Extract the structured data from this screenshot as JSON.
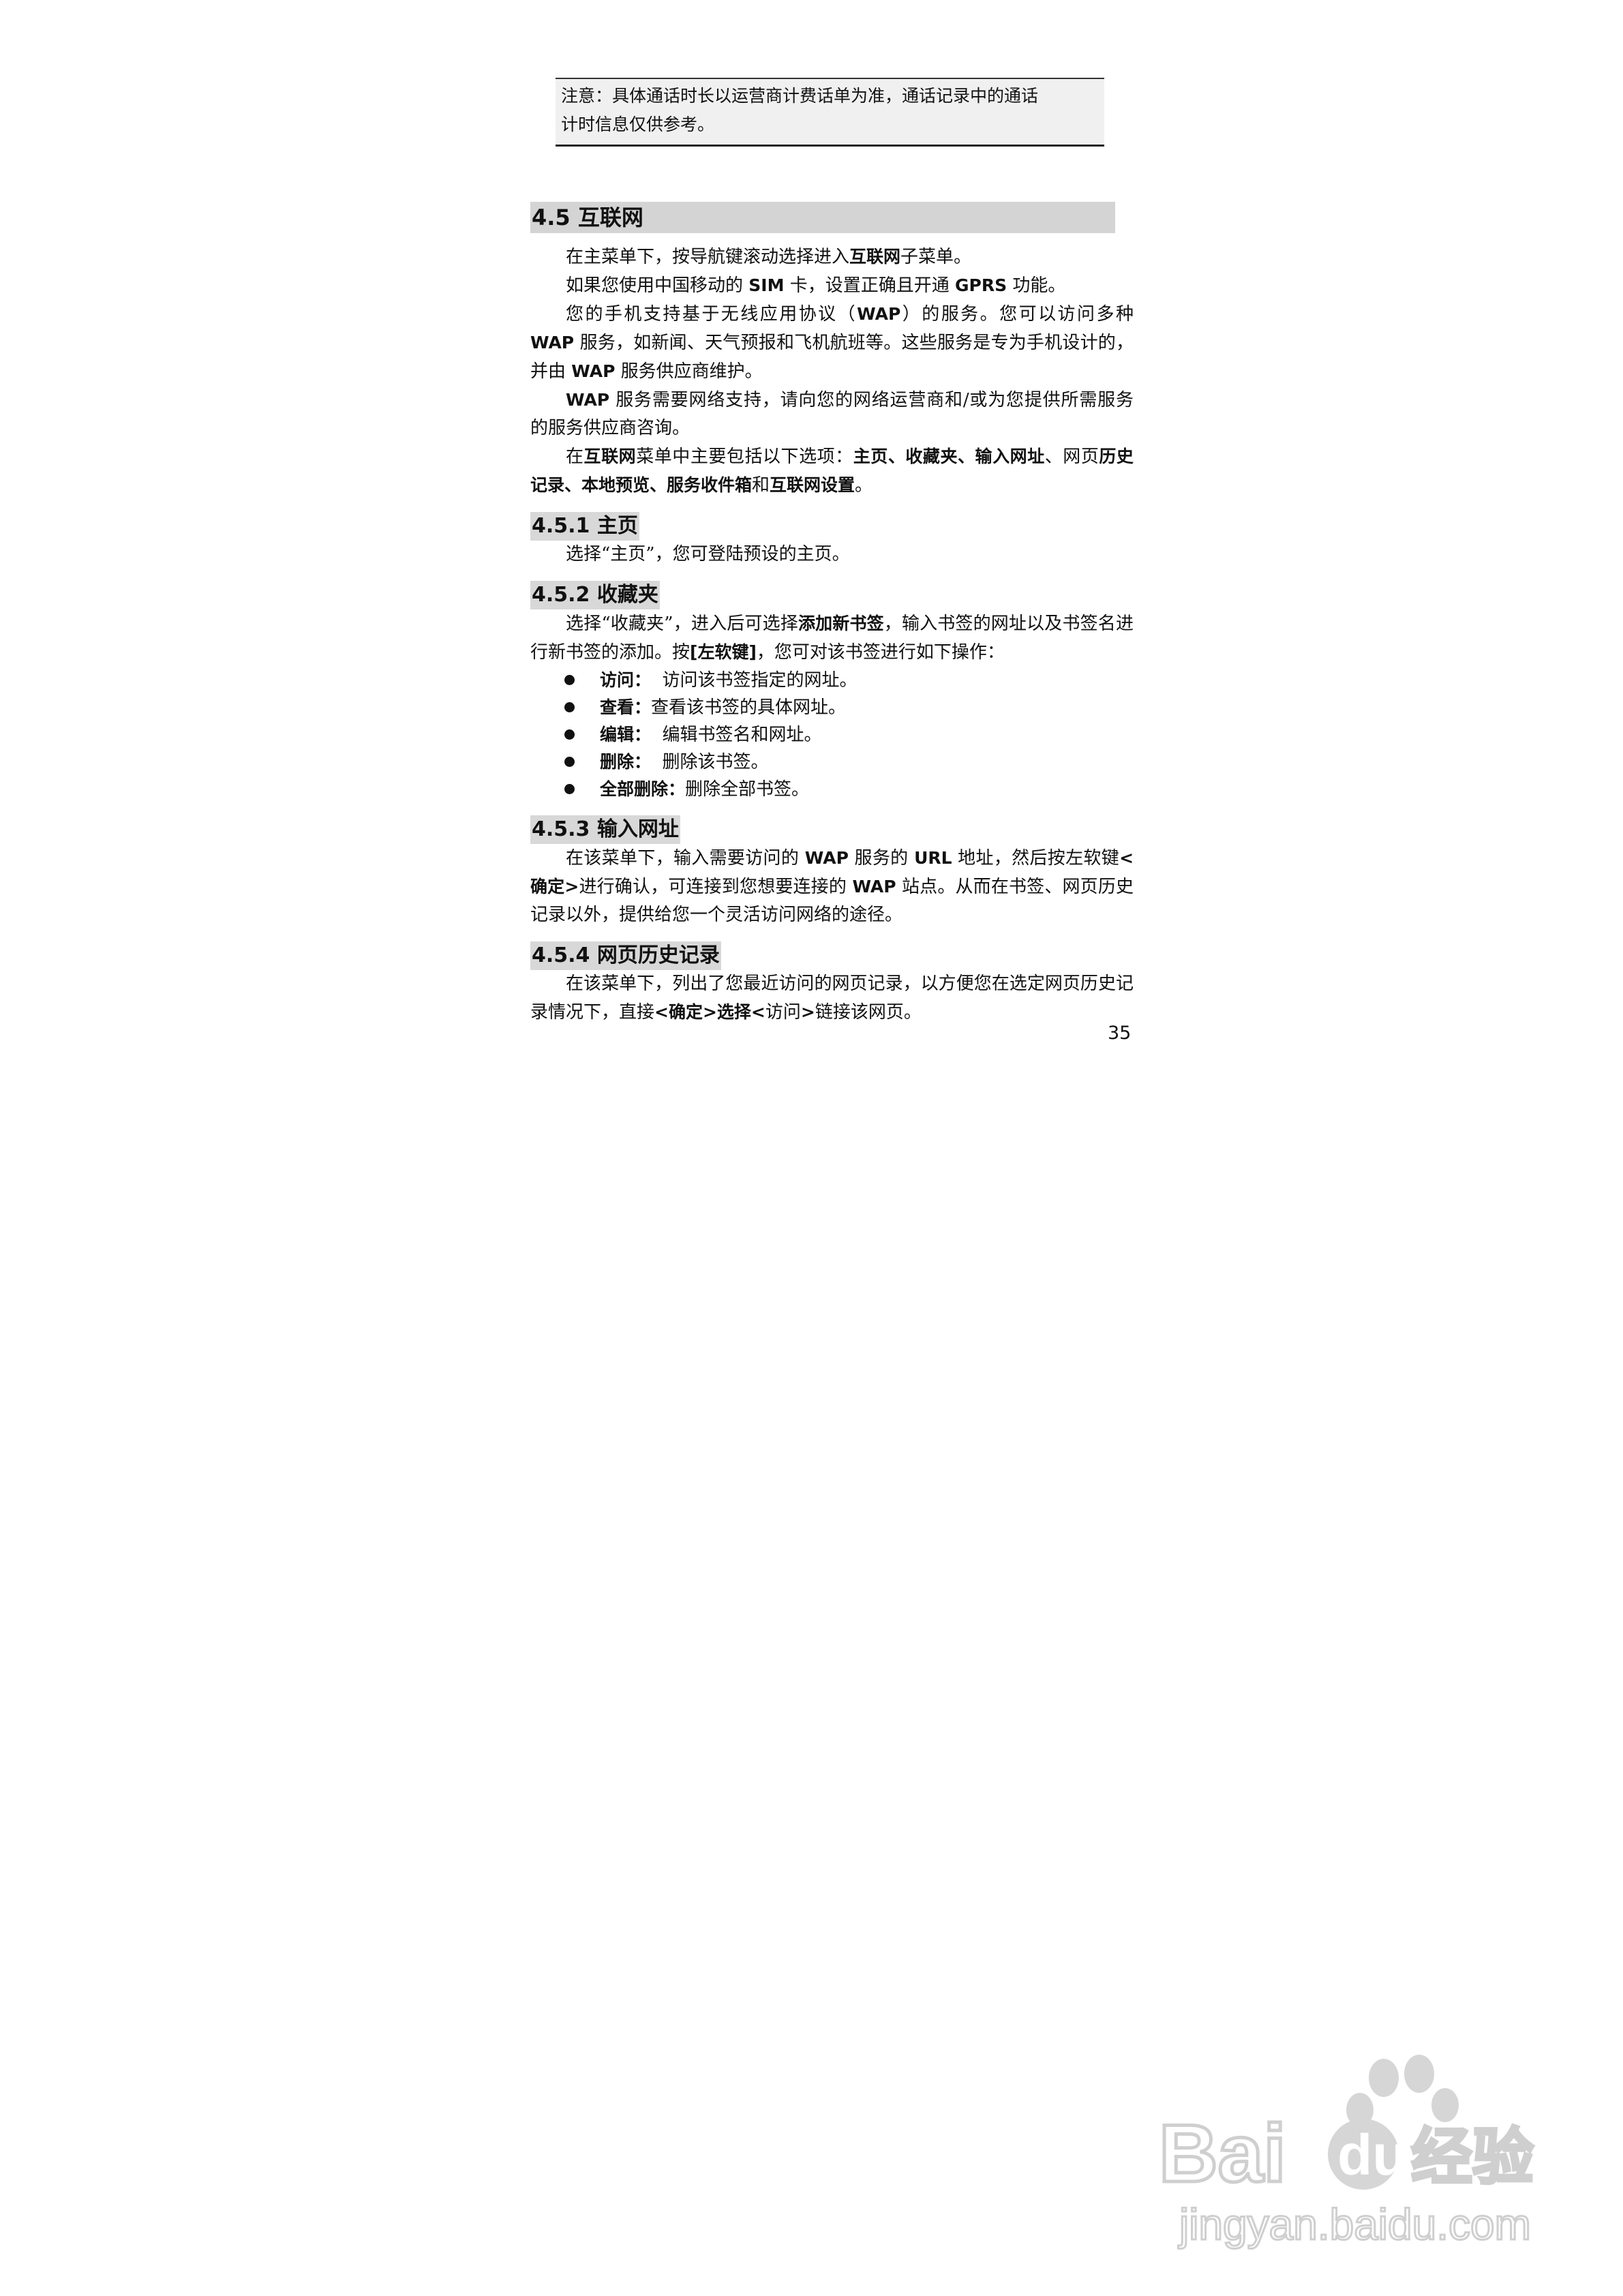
{
  "note": {
    "line1": "注意：具体通话时长以运营商计费话单为准，通话记录中的通话",
    "line2": "计时信息仅供参考。"
  },
  "section": {
    "title": "4.5 互联网",
    "p1": [
      "在主菜单下，按导航键滚动选择进入",
      "互联网",
      "子菜单。"
    ],
    "p2": [
      "如果您使用中国移动的 ",
      "SIM",
      " 卡，设置正确且开通 ",
      "GPRS",
      " 功能。"
    ],
    "p3": [
      "您的手机支持基于无线应用协议（",
      "WAP",
      "）的服务。您可以访问多种 ",
      "WAP",
      " 服务，如新闻、天气预报和飞机航班等。这些服务是专为手机设计的，并由 ",
      "WAP",
      " 服务供应商维护。"
    ],
    "p4": [
      "WAP",
      " 服务需要网络支持，请向您的网络运营商和/或为您提供所需服务的服务供应商咨询。"
    ],
    "p5": [
      "在",
      "互联网",
      "菜单中主要包括以下选项：",
      "主页、收藏夹、输入网址",
      "、网页",
      "历史记录、本地预览、服务收件箱",
      "和",
      "互联网设置",
      "。"
    ]
  },
  "s451": {
    "title": "4.5.1 主页",
    "text": "选择“主页”，您可登陆预设的主页。"
  },
  "s452": {
    "title": "4.5.2 收藏夹",
    "p": [
      "选择“收藏夹”，进入后可选择",
      "添加新书签",
      "，输入书签的网址以及书签名进行新书签的添加。按",
      "[左软键]",
      "，您可对该书签进行如下操作："
    ],
    "items": [
      {
        "label": "访问：",
        "text": "  访问该书签指定的网址。"
      },
      {
        "label": "查看：",
        "text": "查看该书签的具体网址。"
      },
      {
        "label": "编辑：",
        "text": "  编辑书签名和网址。"
      },
      {
        "label": "删除：",
        "text": "  删除该书签。"
      },
      {
        "label": "全部删除：",
        "text": "删除全部书签。"
      }
    ]
  },
  "s453": {
    "title": "4.5.3 输入网址",
    "p": [
      "在该菜单下，输入需要访问的 ",
      "WAP",
      " 服务的 ",
      "URL",
      " 地址，然后按左软键",
      "<确定>",
      "进行确认，可连接到您想要连接的 ",
      "WAP",
      " 站点。从而在书签、网页历史记录以外，提供给您一个灵活访问网络的途径。"
    ]
  },
  "s454": {
    "title": "4.5.4 网页历史记录",
    "p": [
      "在该菜单下，列出了您最近访问的网页记录，以方便您在选定网页历史记录情况下，直接",
      "<确定>选择<",
      "访问",
      ">",
      "链接该网页。"
    ]
  },
  "page_number": "35",
  "watermark": {
    "logo": "Bai du 经验",
    "url": "jingyan.baidu.com"
  },
  "colors": {
    "heading_bg": "#d4d4d4",
    "note_bg": "#f0f0f0",
    "watermark": "#d6d6d6"
  }
}
